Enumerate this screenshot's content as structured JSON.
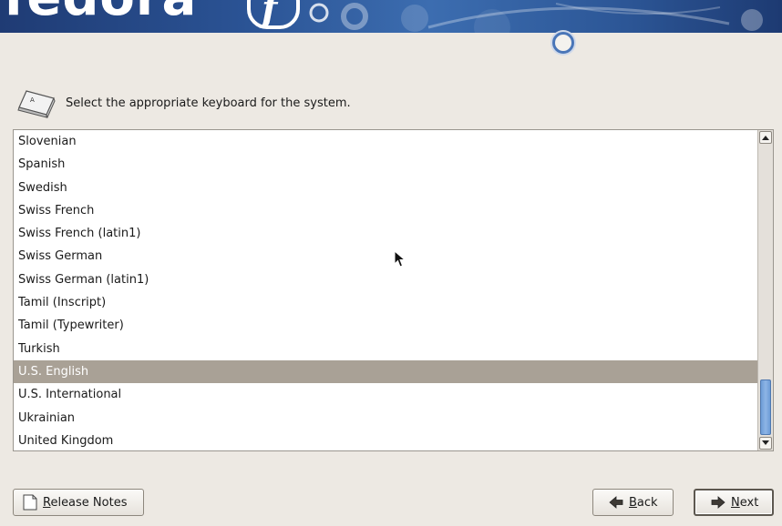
{
  "header": {
    "logo_text": "fedora",
    "logo_mark": "f"
  },
  "prompt": {
    "text": "Select the appropriate keyboard for the system.",
    "icon": "keyboard-key-icon"
  },
  "keyboard_list": {
    "items": [
      "Slovenian",
      "Spanish",
      "Swedish",
      "Swiss French",
      "Swiss French (latin1)",
      "Swiss German",
      "Swiss German (latin1)",
      "Tamil (Inscript)",
      "Tamil (Typewriter)",
      "Turkish",
      "U.S. English",
      "U.S. International",
      "Ukrainian",
      "United Kingdom"
    ],
    "selected": "U.S. English"
  },
  "buttons": {
    "release_notes": {
      "label_first": "R",
      "label_rest": "elease Notes",
      "icon": "document-icon"
    },
    "back": {
      "label_first": "B",
      "label_rest": "ack",
      "icon": "arrow-left-icon"
    },
    "next": {
      "label_first": "N",
      "label_rest": "ext",
      "icon": "arrow-right-icon"
    }
  },
  "colors": {
    "banner": "#2a5293",
    "selection": "#a9a196",
    "scroll_thumb": "#7aa6dc",
    "background": "#ede9e3"
  }
}
